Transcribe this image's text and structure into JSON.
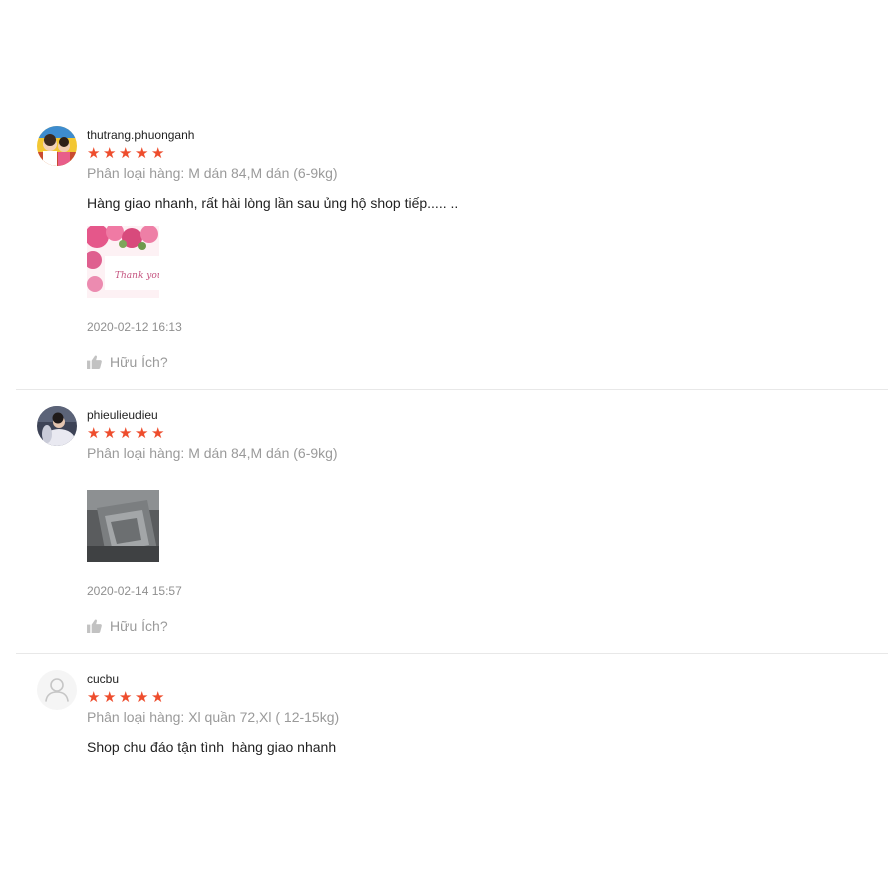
{
  "colors": {
    "star": "#ee4d2d",
    "muted": "#9a9a9a",
    "divider": "#e8e8e8"
  },
  "reviews": [
    {
      "author": "thutrang.phuonganh",
      "stars": "★★★★★",
      "rating": 5,
      "variation": "Phân loại hàng: M dán 84,M dán (6-9kg)",
      "comment": "Hàng giao nhanh, rất hài lòng lần sau ủng hộ shop tiếp..... ..",
      "image_text": "Thank you",
      "timestamp": "2020-02-12 16:13",
      "helpful_label": "Hữu Ích?",
      "helpful_icon": "thumbs-up-icon"
    },
    {
      "author": "phieulieudieu",
      "stars": "★★★★★",
      "rating": 5,
      "variation": "Phân loại hàng: M dán 84,M dán (6-9kg)",
      "timestamp": "2020-02-14 15:57",
      "helpful_label": "Hữu Ích?",
      "helpful_icon": "thumbs-up-icon"
    },
    {
      "author": "cucbu",
      "stars": "★★★★★",
      "rating": 5,
      "variation": "Phân loại hàng: Xl quần 72,Xl ( 12-15kg)",
      "comment": "Shop chu đáo tận tình  hàng giao nhanh"
    }
  ]
}
